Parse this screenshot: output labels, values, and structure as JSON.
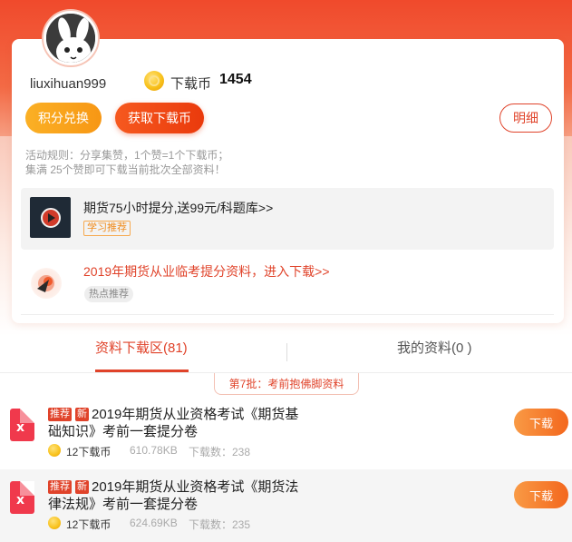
{
  "user": {
    "name": "liuxihuan999",
    "coin_label": "下载币",
    "coin_value": "1454"
  },
  "buttons": {
    "exchange": "积分兑换",
    "get_coins": "获取下载币",
    "detail": "明细"
  },
  "rules": {
    "line1": "活动规则：分享集赞，1个赞=1个下载币；",
    "line2": "集满 25个赞即可下载当前批次全部资料！"
  },
  "promo": {
    "title": "期货75小时提分,送99元/科题库>>",
    "tag": "学习推荐"
  },
  "hot": {
    "title": "2019年期货从业临考提分资料，进入下载>>",
    "tag": "热点推荐"
  },
  "tabs": {
    "downloads": "资料下载区(81)",
    "mine": "我的资料(0 )"
  },
  "batch": {
    "label": "第7批：考前抱佛脚资料"
  },
  "files": [
    {
      "badge_rec": "推荐",
      "badge_new": "新",
      "title": "2019年期货从业资格考试《期货基础知识》考前一套提分卷",
      "price": "12下载币",
      "size": "610.78KB",
      "downloads": "下载数：238",
      "button": "下载"
    },
    {
      "badge_rec": "推荐",
      "badge_new": "新",
      "title": "2019年期货从业资格考试《期货法律法规》考前一套提分卷",
      "price": "12下载币",
      "size": "624.69KB",
      "downloads": "下载数：235",
      "button": "下载"
    }
  ],
  "colors": {
    "brand": "#e0432a",
    "orange": "#f79714",
    "hero": "#f04a2c"
  }
}
